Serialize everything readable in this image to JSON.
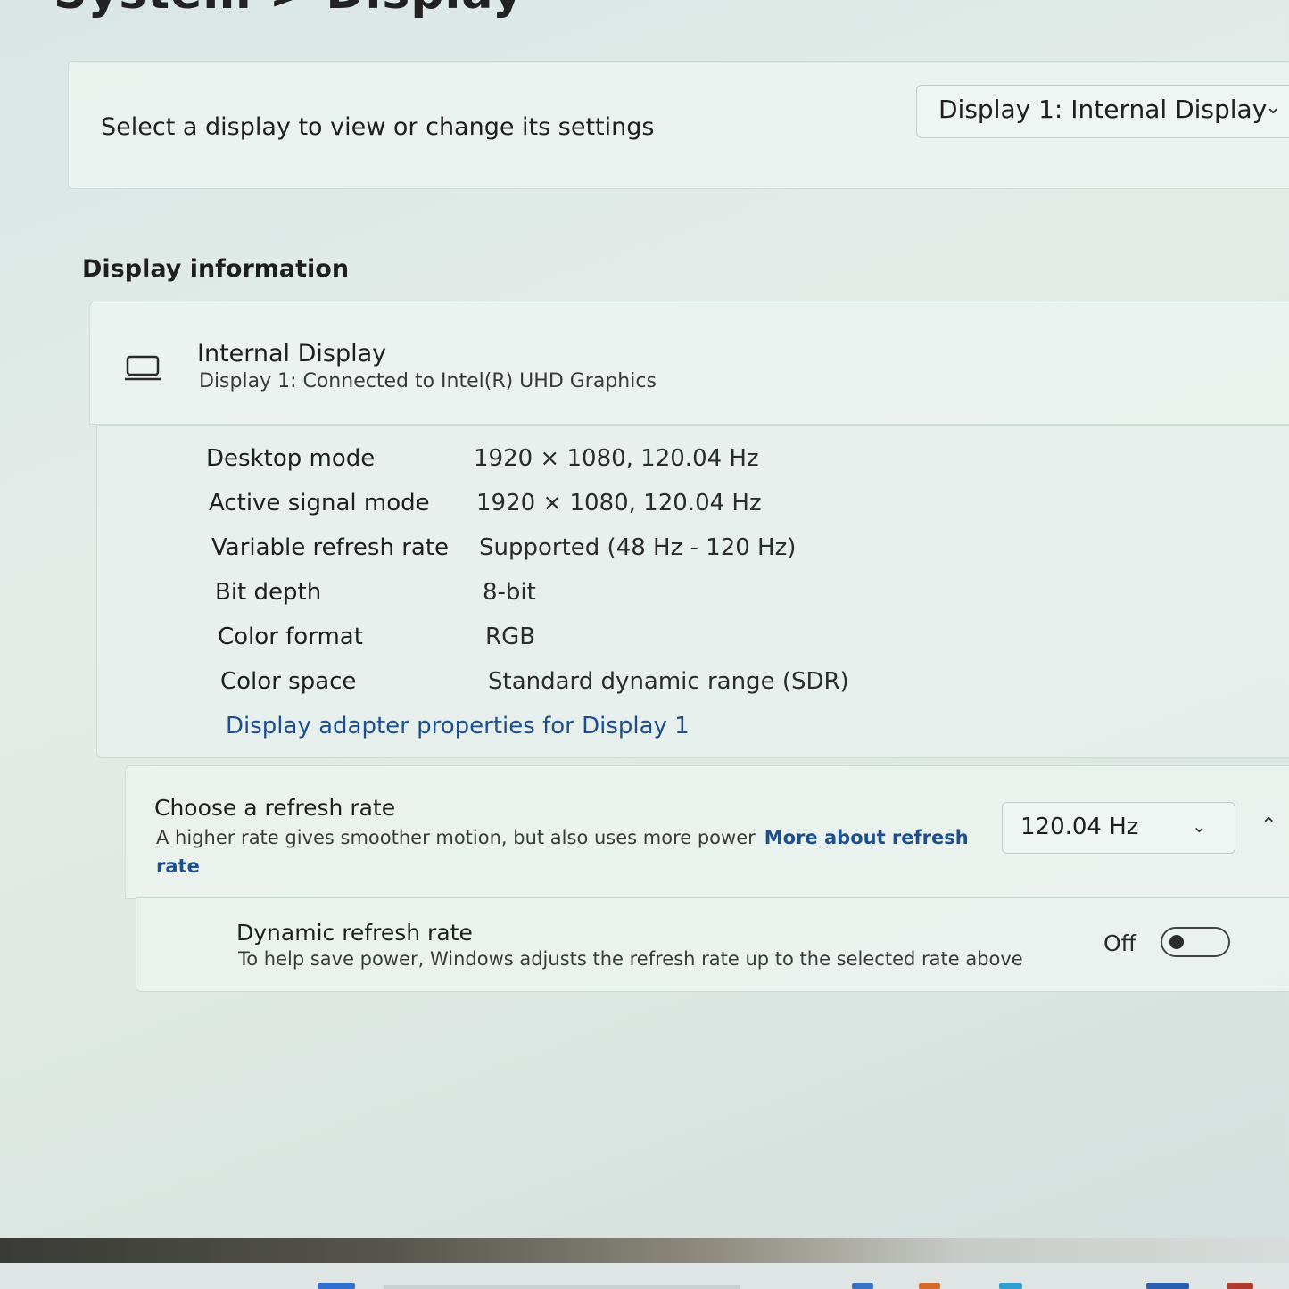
{
  "header": {
    "title_partial": "System  >  Display"
  },
  "select_display": {
    "label": "Select a display to view or change its settings",
    "selected": "Display 1: Internal Display"
  },
  "display_information": {
    "section_title": "Display information",
    "name": "Internal Display",
    "subtitle": "Display 1: Connected to Intel(R) UHD Graphics",
    "properties": [
      {
        "label": "Desktop mode",
        "value": "1920 × 1080, 120.04 Hz"
      },
      {
        "label": "Active signal mode",
        "value": "1920 × 1080, 120.04 Hz"
      },
      {
        "label": "Variable refresh rate",
        "value": "Supported (48 Hz - 120 Hz)"
      },
      {
        "label": "Bit depth",
        "value": "8-bit"
      },
      {
        "label": "Color format",
        "value": "RGB"
      },
      {
        "label": "Color space",
        "value": "Standard dynamic range (SDR)"
      }
    ],
    "adapter_link": "Display adapter properties for Display 1"
  },
  "refresh_rate": {
    "title": "Choose a refresh rate",
    "description": "A higher rate gives smoother motion, but also uses more power",
    "link": "More about refresh rate",
    "selected": "120.04 Hz"
  },
  "dynamic_refresh": {
    "title": "Dynamic refresh rate",
    "description": "To help save power, Windows adjusts the refresh rate up to the selected rate above",
    "state_label": "Off",
    "enabled": false
  },
  "icons": [
    "laptop-icon",
    "chevron-down-icon",
    "chevron-up-icon"
  ],
  "colors": {
    "link": "#1d4f8c",
    "background": "#dfe8e3"
  }
}
